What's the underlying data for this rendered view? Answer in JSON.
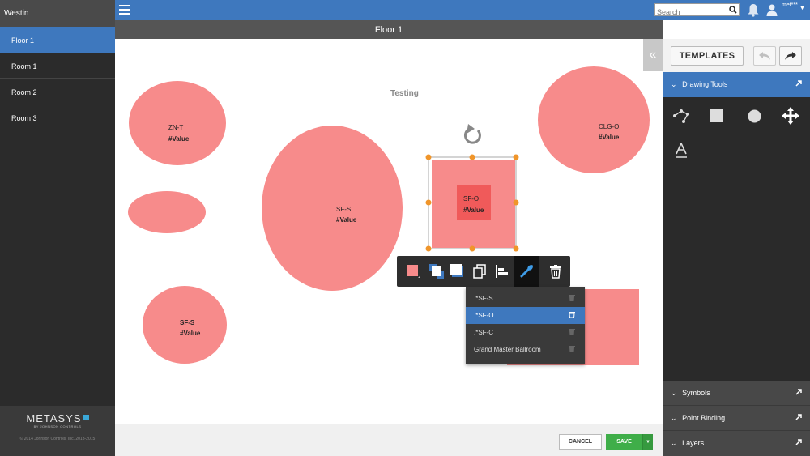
{
  "sidebar": {
    "site_name": "Westin",
    "items": [
      {
        "label": "Floor 1"
      },
      {
        "label": "Room 1"
      },
      {
        "label": "Room 2"
      },
      {
        "label": "Room 3"
      }
    ],
    "logo": "METASYS",
    "logo_sub": "BY JOHNSON CONTROLS",
    "copyright": "© 2014 Johnson Controls, Inc. 2013-2015"
  },
  "topbar": {
    "search_placeholder": "Search",
    "username": "met***"
  },
  "page_title": "Floor 1",
  "canvas": {
    "title": "Testing",
    "shapes": [
      {
        "name": "ZN-T",
        "value": "#Value"
      },
      {
        "name": "SF-S",
        "value": "#Value"
      },
      {
        "name": "SF-S",
        "value": "#Value"
      },
      {
        "name": "SF-O",
        "value": "#Value"
      },
      {
        "name": "CLG-O",
        "value": "#Value"
      }
    ]
  },
  "layer_menu": {
    "items": [
      {
        "label": ".*SF-S"
      },
      {
        "label": ".*SF-O"
      },
      {
        "label": ".*SF-C"
      },
      {
        "label": "Grand Master Ballroom"
      }
    ]
  },
  "actions": {
    "cancel_label": "CANCEL",
    "save_label": "SAVE"
  },
  "right_panel": {
    "templates_label": "TEMPLATES",
    "sections": {
      "drawing_tools": "Drawing Tools",
      "symbols": "Symbols",
      "point_binding": "Point Binding",
      "layers": "Layers"
    }
  },
  "colors": {
    "accent": "#3e78be",
    "shape_fill": "#f78b8b",
    "shape_selected": "#f05a5a",
    "save_green": "#3fae49"
  }
}
